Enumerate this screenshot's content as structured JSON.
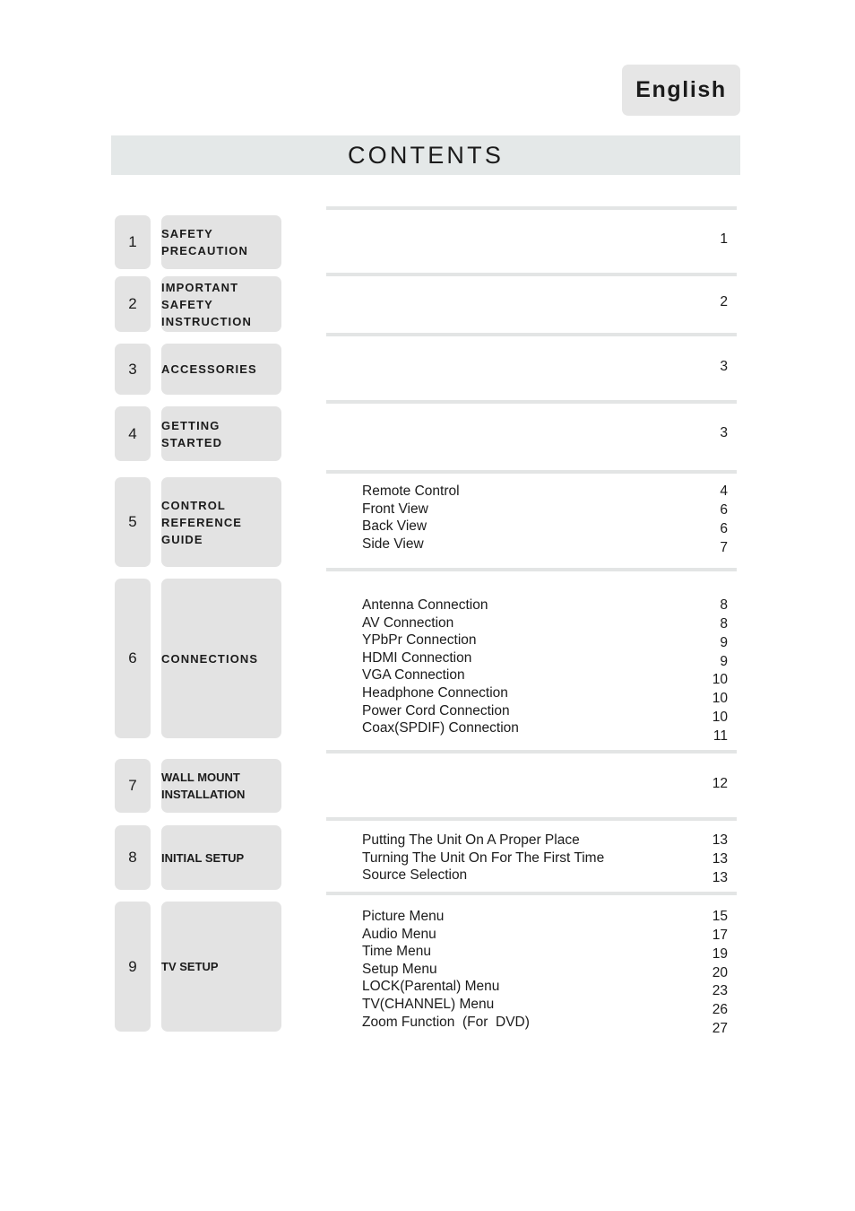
{
  "language_badge": {
    "label": "English"
  },
  "page_title": {
    "label": "CONTENTS"
  },
  "toc": {
    "sections": [
      {
        "number": "1",
        "label": "SAFETY\nPRECAUTION",
        "page": "1",
        "entries": []
      },
      {
        "number": "2",
        "label": "IMPORTANT\nSAFETY\nINSTRUCTION",
        "page": "2",
        "entries": []
      },
      {
        "number": "3",
        "label": "ACCESSORIES",
        "page": "3",
        "entries": []
      },
      {
        "number": "4",
        "label": "GETTING\nSTARTED",
        "page": "3",
        "entries": []
      },
      {
        "number": "5",
        "label": "CONTROL\nREFERENCE\nGUIDE",
        "page": "",
        "entries": [
          {
            "title": "Remote Control",
            "page": "4"
          },
          {
            "title": "Front View",
            "page": "6"
          },
          {
            "title": "Back View",
            "page": "6"
          },
          {
            "title": "Side View",
            "page": "7"
          }
        ]
      },
      {
        "number": "6",
        "label": "CONNECTIONS",
        "page": "",
        "entries": [
          {
            "title": "Antenna Connection",
            "page": "8"
          },
          {
            "title": "AV Connection",
            "page": "8"
          },
          {
            "title": "YPbPr Connection",
            "page": "9"
          },
          {
            "title": "HDMI Connection",
            "page": "9"
          },
          {
            "title": "VGA Connection",
            "page": "10"
          },
          {
            "title": "Headphone Connection",
            "page": "10"
          },
          {
            "title": "Power Cord Connection",
            "page": "10"
          },
          {
            "title": "Coax(SPDIF) Connection",
            "page": "11"
          }
        ]
      },
      {
        "number": "7",
        "label": "WALL MOUNT\nINSTALLATION",
        "page": "12",
        "entries": []
      },
      {
        "number": "8",
        "label": "INITIAL SETUP",
        "page": "",
        "entries": [
          {
            "title": "Putting The Unit On A Proper Place",
            "page": "13"
          },
          {
            "title": "Turning The Unit On For The First Time",
            "page": "13"
          },
          {
            "title": "Source Selection",
            "page": "13"
          }
        ]
      },
      {
        "number": "9",
        "label": "TV SETUP",
        "page": "",
        "entries": [
          {
            "title": "Picture Menu",
            "page": "15"
          },
          {
            "title": "Audio Menu",
            "page": "17"
          },
          {
            "title": "Time Menu",
            "page": "19"
          },
          {
            "title": "Setup Menu",
            "page": "20"
          },
          {
            "title": "LOCK(Parental) Menu",
            "page": "23"
          },
          {
            "title": "TV(CHANNEL) Menu",
            "page": "26"
          },
          {
            "title": "Zoom Function  (For  DVD)",
            "page": "27"
          }
        ]
      }
    ]
  }
}
